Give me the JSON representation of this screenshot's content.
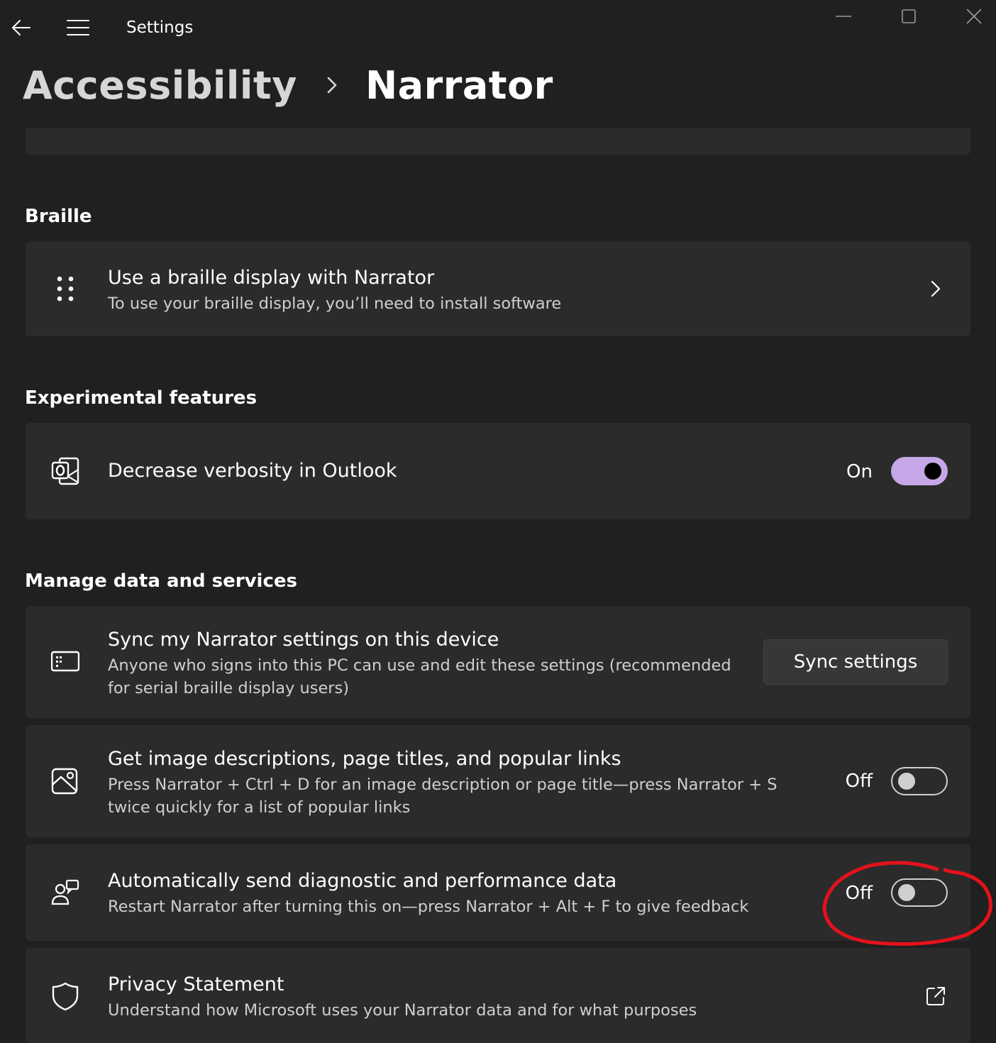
{
  "window": {
    "app_title": "Settings",
    "back_icon": "back-arrow-icon",
    "menu_icon": "hamburger-menu-icon",
    "controls": [
      "minimize-icon",
      "maximize-icon",
      "close-icon"
    ]
  },
  "breadcrumb": {
    "parent": "Accessibility",
    "separator_icon": "chevron-right-icon",
    "current": "Narrator"
  },
  "sections": {
    "braille": {
      "header": "Braille",
      "item": {
        "icon": "braille-dots-icon",
        "title": "Use a braille display with Narrator",
        "description": "To use your braille display, you’ll need to install software"
      }
    },
    "experimental": {
      "header": "Experimental features",
      "item": {
        "icon": "outlook-icon",
        "title": "Decrease verbosity in Outlook",
        "state_label": "On",
        "state": true
      }
    },
    "manage_data": {
      "header": "Manage data and services",
      "sync": {
        "icon": "keyboard-sync-icon",
        "title": "Sync my Narrator settings on this device",
        "description": "Anyone who signs into this PC can use and edit these settings (recommended for serial braille display users)",
        "button_label": "Sync settings"
      },
      "image_desc": {
        "icon": "image-icon",
        "title": "Get image descriptions, page titles, and popular links",
        "description": "Press Narrator + Ctrl + D for an image description or page title—press Narrator + S twice quickly for a list of popular links",
        "state_label": "Off",
        "state": false
      },
      "diagnostics": {
        "icon": "feedback-person-icon",
        "title": "Automatically send diagnostic and performance data",
        "description": "Restart Narrator after turning this on—press Narrator + Alt + F to give feedback",
        "state_label": "Off",
        "state": false
      },
      "privacy": {
        "icon": "shield-icon",
        "title": "Privacy Statement",
        "description": "Understand how Microsoft uses your Narrator data and for what purposes",
        "link_icon": "external-link-icon"
      }
    }
  },
  "colors": {
    "background": "#202020",
    "card": "#2b2b2b",
    "accent_toggle": "#c6a8e8",
    "annotation": "#e3121b"
  }
}
